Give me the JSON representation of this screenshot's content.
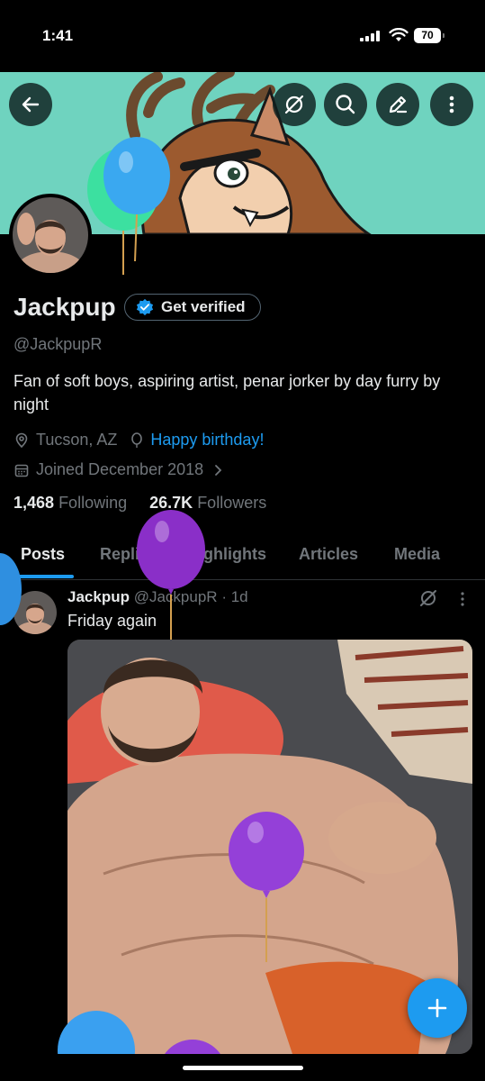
{
  "status_bar": {
    "time": "1:41",
    "battery": "70"
  },
  "profile": {
    "name": "Jackpup",
    "verify_label": "Get verified",
    "handle": "@JackpupR",
    "bio": "Fan of soft boys, aspiring artist, penar jorker by day furry by night",
    "location": "Tucson, AZ",
    "birthday_link": "Happy birthday!",
    "joined": "Joined December 2018",
    "following_count": "1,468",
    "following_label": "Following",
    "followers_count": "26.7K",
    "followers_label": "Followers"
  },
  "tabs": [
    "Posts",
    "Replies",
    "Highlights",
    "Articles",
    "Media"
  ],
  "post": {
    "name": "Jackpup",
    "handle": "@JackpupR",
    "time": "· 1d",
    "text": "Friday again"
  },
  "colors": {
    "accent": "#1d9bf0",
    "background": "#000000",
    "muted": "#71767b",
    "text": "#e7e9ea"
  },
  "icons": [
    "back-arrow-icon",
    "grok-icon",
    "search-icon",
    "edit-icon",
    "more-vertical-icon",
    "verified-badge-icon",
    "location-pin-icon",
    "balloon-icon",
    "calendar-icon",
    "chevron-right-icon",
    "plus-icon"
  ]
}
